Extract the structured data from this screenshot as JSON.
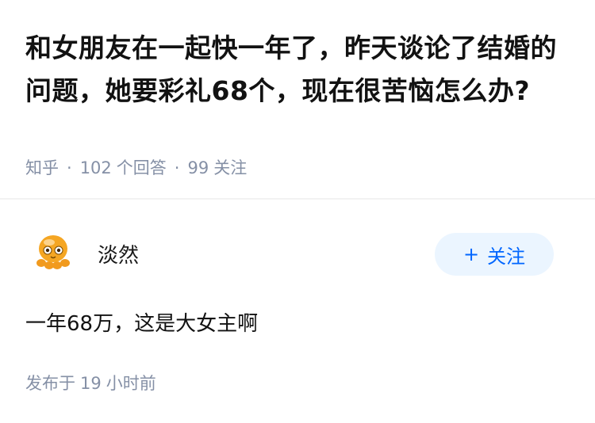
{
  "question": {
    "title": "和女朋友在一起快一年了，昨天谈论了结婚的问题，她要彩礼68个，现在很苦恼怎么办?",
    "source": "知乎",
    "answer_count": "102",
    "answer_unit": "个回答",
    "follow_count": "99",
    "follow_unit": "关注"
  },
  "answer": {
    "author_name": "淡然",
    "avatar_icon": "octopus-avatar-icon",
    "follow_button_label": "关注",
    "follow_button_plus": "+",
    "content": "一年68万，这是大女主啊",
    "time_prefix": "发布于",
    "time_value": "19",
    "time_suffix": "小时前"
  },
  "colors": {
    "accent": "#0066ff",
    "button_bg": "#ebf5ff",
    "meta_text": "#8590a6",
    "avatar_orange": "#f5a623"
  }
}
